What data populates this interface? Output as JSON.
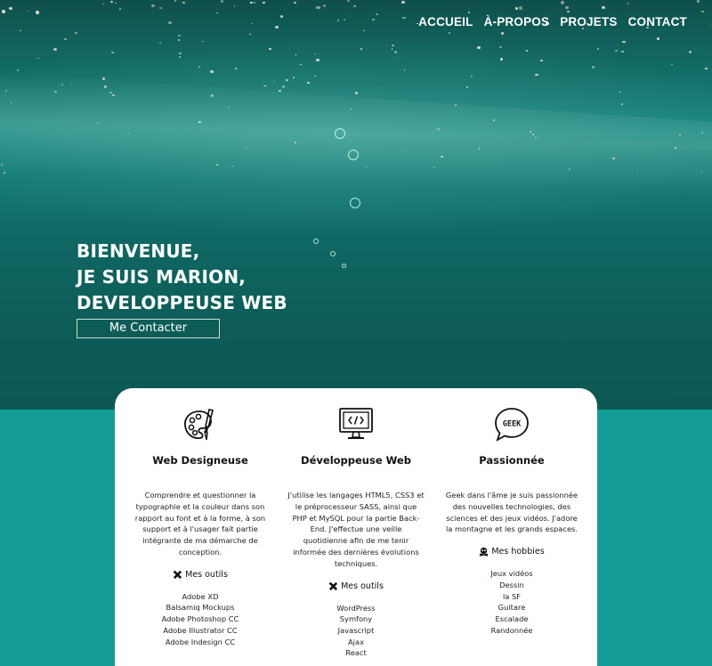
{
  "nav": {
    "items": [
      "ACCUEIL",
      "À-PROPOS",
      "PROJETS",
      "CONTACT"
    ]
  },
  "hero": {
    "lines": [
      "BIENVENUE,",
      "JE SUIS MARION,",
      "DEVELOPPEUSE WEB"
    ],
    "cta_label": "Me Contacter"
  },
  "cards": [
    {
      "title": "Web Designeuse",
      "icon": "palette-icon",
      "text": "Comprendre et questionner la typographie et la couleur dans son rapport au font et à la forme, à son support et à l'usager fait partie intégrante de ma démarche de conception.",
      "sub_label": "Mes outils",
      "sub_icon": "tools-icon",
      "items": [
        "Adobe XD",
        "Balsamiq Mockups",
        "Adobe Photoshop CC",
        "Adobe Illustrator CC",
        "Adobe Indesign CC"
      ]
    },
    {
      "title": "Développeuse Web",
      "icon": "monitor-code-icon",
      "text": "J'utilise les langages HTML5, CSS3 et le préprocesseur SASS, ainsi que PHP et MySQL pour la partie Back-End. J'effectue une veille quotidienne afin de me tenir informée des dernières évolutions techniques.",
      "sub_label": "Mes outils",
      "sub_icon": "tools-icon",
      "items": [
        "WordPress",
        "Symfony",
        "Javascript",
        "Ajax",
        "React"
      ]
    },
    {
      "title": "Passionnée",
      "icon": "geek-speech-bubble-icon",
      "icon_text": "GEEK",
      "text": "Geek dans l'âme je suis passionnée des nouvelles technologies, des sciences et des jeux vidéos. J'adore la montagne et les grands espaces.",
      "sub_label": "Mes hobbies",
      "sub_icon": "skull-crossbones-icon",
      "items": [
        "Jeux vidéos",
        "Dessin",
        "la SF",
        "Guitare",
        "Escalade",
        "Randonnée"
      ]
    }
  ]
}
